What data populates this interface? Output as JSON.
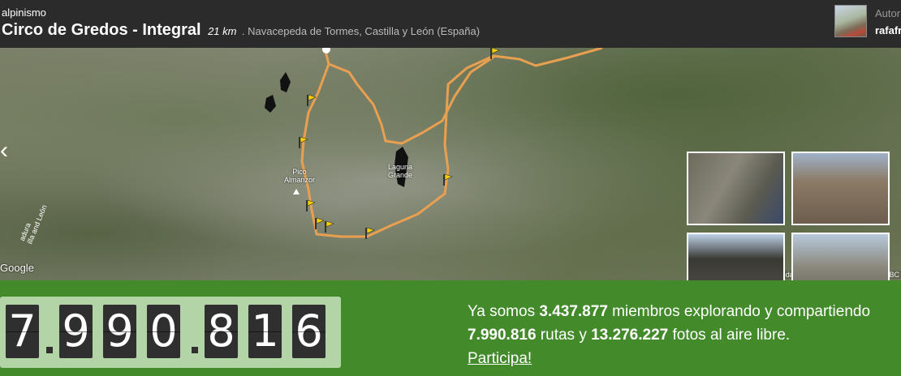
{
  "header": {
    "category": "alpinismo",
    "title": "Circo de Gredos - Integral",
    "distance": "21 km",
    "location": ". Navacepeda de Tormes, Castilla y León (España)",
    "author_label": "Autor",
    "author_name": "rafafr"
  },
  "map": {
    "pico_label_1": "Pico",
    "pico_label_2": "Almanzor",
    "laguna_label_1": "Laguna",
    "laguna_label_2": "Grande",
    "google": "Google",
    "road_label": "adura\nilla and León",
    "attribution": "Map data ©2013 Google, basado en BC"
  },
  "counter": {
    "digits": [
      "7",
      "9",
      "9",
      "0",
      "8",
      "1",
      "6"
    ]
  },
  "stats": {
    "prefix": "Ya somos ",
    "members": "3.437.877",
    "mid": " miembros explorando y compartiendo",
    "routes": "7.990.816",
    "routes_text": " rutas y ",
    "photos": "13.276.227",
    "photos_text": " fotos al aire libre.",
    "cta": "Participa!"
  },
  "colors": {
    "band": "#438a2b",
    "counter_bg": "#b2d4a6",
    "route": "#e8a050"
  }
}
